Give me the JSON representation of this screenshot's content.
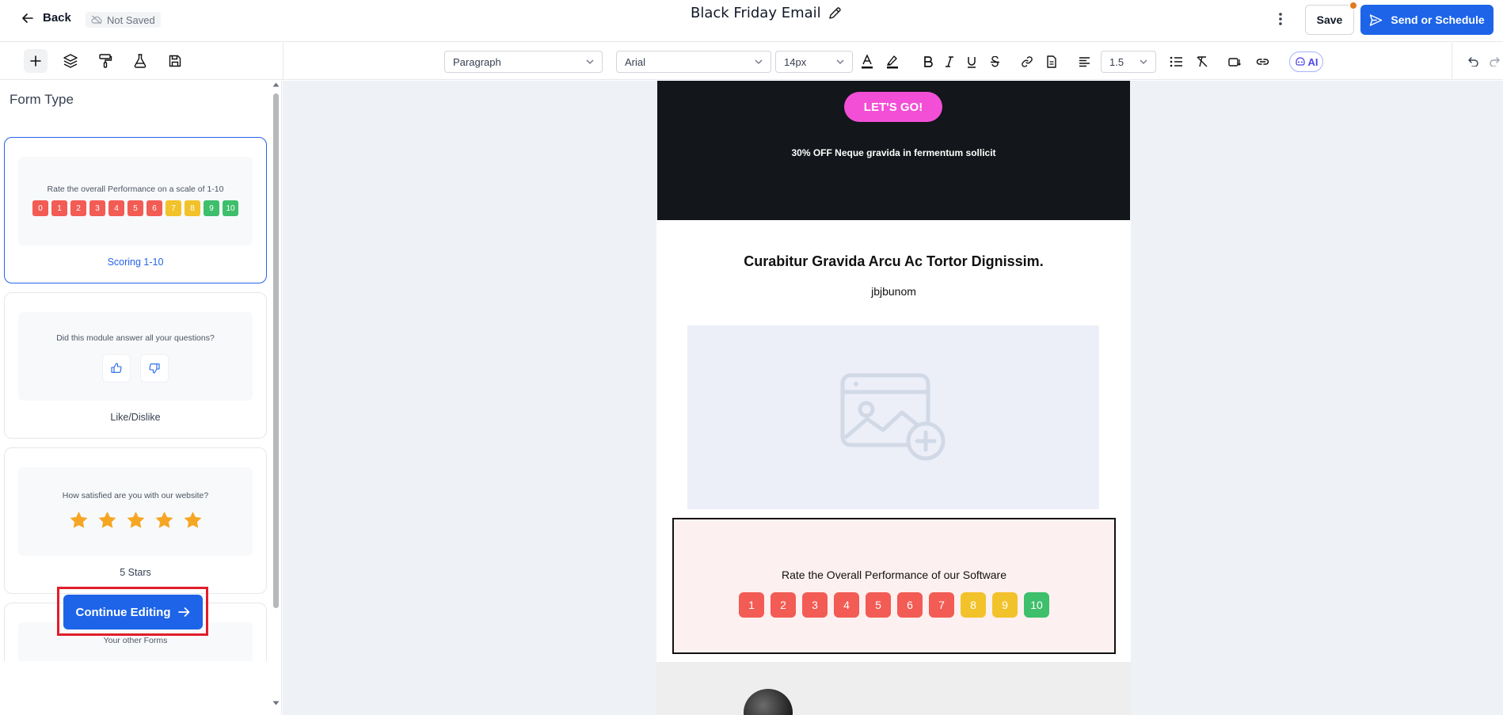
{
  "header": {
    "back_label": "Back",
    "save_status": "Not Saved",
    "doc_title": "Black Friday Email",
    "save_label": "Save",
    "send_label": "Send or Schedule"
  },
  "toolbar": {
    "block_type": "Paragraph",
    "font_family": "Arial",
    "font_size": "14px",
    "line_height": "1.5",
    "ai_label": "AI"
  },
  "sidebar": {
    "title": "Form Type",
    "cards": [
      {
        "question": "Rate the overall Performance on a scale of 1-10",
        "label": "Scoring 1-10",
        "scores": [
          "0",
          "1",
          "2",
          "3",
          "4",
          "5",
          "6",
          "7",
          "8",
          "9",
          "10"
        ]
      },
      {
        "question": "Did this module answer all your questions?",
        "label": "Like/Dislike"
      },
      {
        "question": "How satisfied are you with our website?",
        "label": "5 Stars"
      },
      {
        "question": "Your other Forms"
      }
    ],
    "continue_label": "Continue Editing"
  },
  "email": {
    "cta_label": "LET'S GO!",
    "promo_text": "30% OFF Neque gravida in fermentum sollicit",
    "heading": "Curabitur Gravida Arcu Ac Tortor Dignissim.",
    "subtext": "jbjbunom",
    "rating": {
      "title": "Rate the Overall Performance of our Software",
      "scores": [
        "1",
        "2",
        "3",
        "4",
        "5",
        "6",
        "7",
        "8",
        "9",
        "10"
      ]
    }
  },
  "colors": {
    "primary": "#1d64e8",
    "score_red": "#f25c54",
    "score_yellow": "#f2c22b",
    "score_green": "#3dbf6b",
    "cta_pink": "#f24fd6",
    "star": "#f5a623"
  }
}
